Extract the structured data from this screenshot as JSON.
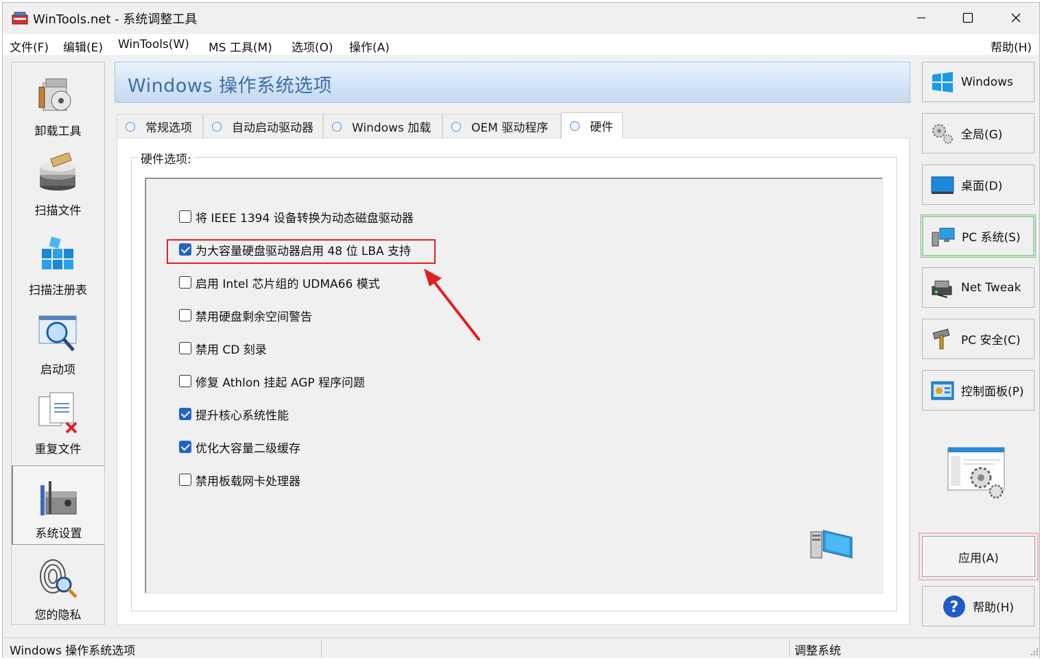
{
  "window": {
    "title": "WinTools.net - 系统调整工具",
    "minimize": "—",
    "maximize": "☐",
    "close": "✕"
  },
  "menu": {
    "items": [
      "文件(F)",
      "编辑(E)",
      "WinTools(W)",
      "MS 工具(M)",
      "选项(O)",
      "操作(A)"
    ],
    "help": "帮助(H)"
  },
  "sidebar": {
    "items": [
      {
        "label": "卸载工具",
        "icon": "uninstall-icon"
      },
      {
        "label": "扫描文件",
        "icon": "scan-files-icon"
      },
      {
        "label": "扫描注册表",
        "icon": "scan-registry-icon"
      },
      {
        "label": "启动项",
        "icon": "startup-icon"
      },
      {
        "label": "重复文件",
        "icon": "duplicate-files-icon"
      },
      {
        "label": "系统设置",
        "icon": "system-settings-icon",
        "active": true
      },
      {
        "label": "您的隐私",
        "icon": "privacy-icon"
      }
    ]
  },
  "header": {
    "title": "Windows 操作系统选项"
  },
  "tabs": [
    {
      "label": "常规选项"
    },
    {
      "label": "自动启动驱动器"
    },
    {
      "label": "Windows 加载"
    },
    {
      "label": "OEM 驱动程序"
    },
    {
      "label": "硬件",
      "active": true
    }
  ],
  "hardware": {
    "group_label": "硬件选项:",
    "options": [
      {
        "label": "将 IEEE 1394 设备转换为动态磁盘驱动器",
        "checked": false
      },
      {
        "label": "为大容量硬盘驱动器启用 48 位 LBA 支持",
        "checked": true,
        "highlighted": true
      },
      {
        "label": "启用 Intel 芯片组的 UDMA66 模式",
        "checked": false
      },
      {
        "label": "禁用硬盘剩余空间警告",
        "checked": false
      },
      {
        "label": "禁用 CD 刻录",
        "checked": false
      },
      {
        "label": "修复 Athlon 挂起 AGP 程序问题",
        "checked": false
      },
      {
        "label": "提升核心系统性能",
        "checked": true
      },
      {
        "label": "优化大容量二级缓存",
        "checked": true
      },
      {
        "label": "禁用板载网卡处理器",
        "checked": false
      }
    ]
  },
  "rightbar": {
    "buttons": [
      {
        "label": "Windows",
        "icon": "windows-logo-icon"
      },
      {
        "label": "全局(G)",
        "icon": "gears-icon"
      },
      {
        "label": "桌面(D)",
        "icon": "desktop-icon"
      },
      {
        "label": "PC 系统(S)",
        "icon": "pc-system-icon",
        "selected": true
      },
      {
        "label": "Net Tweak",
        "icon": "network-icon"
      },
      {
        "label": "PC 安全(C)",
        "icon": "security-hammer-icon"
      },
      {
        "label": "控制面板(P)",
        "icon": "control-panel-icon"
      }
    ],
    "apply": "应用(A)",
    "help": "帮助(H)"
  },
  "status": {
    "left": "Windows 操作系统选项",
    "right": "调整系统"
  },
  "colors": {
    "header_text": "#3d6ea6",
    "checkbox_checked": "#1f64c8",
    "highlight": "#e02020",
    "selected_border": "#9ed49e"
  }
}
